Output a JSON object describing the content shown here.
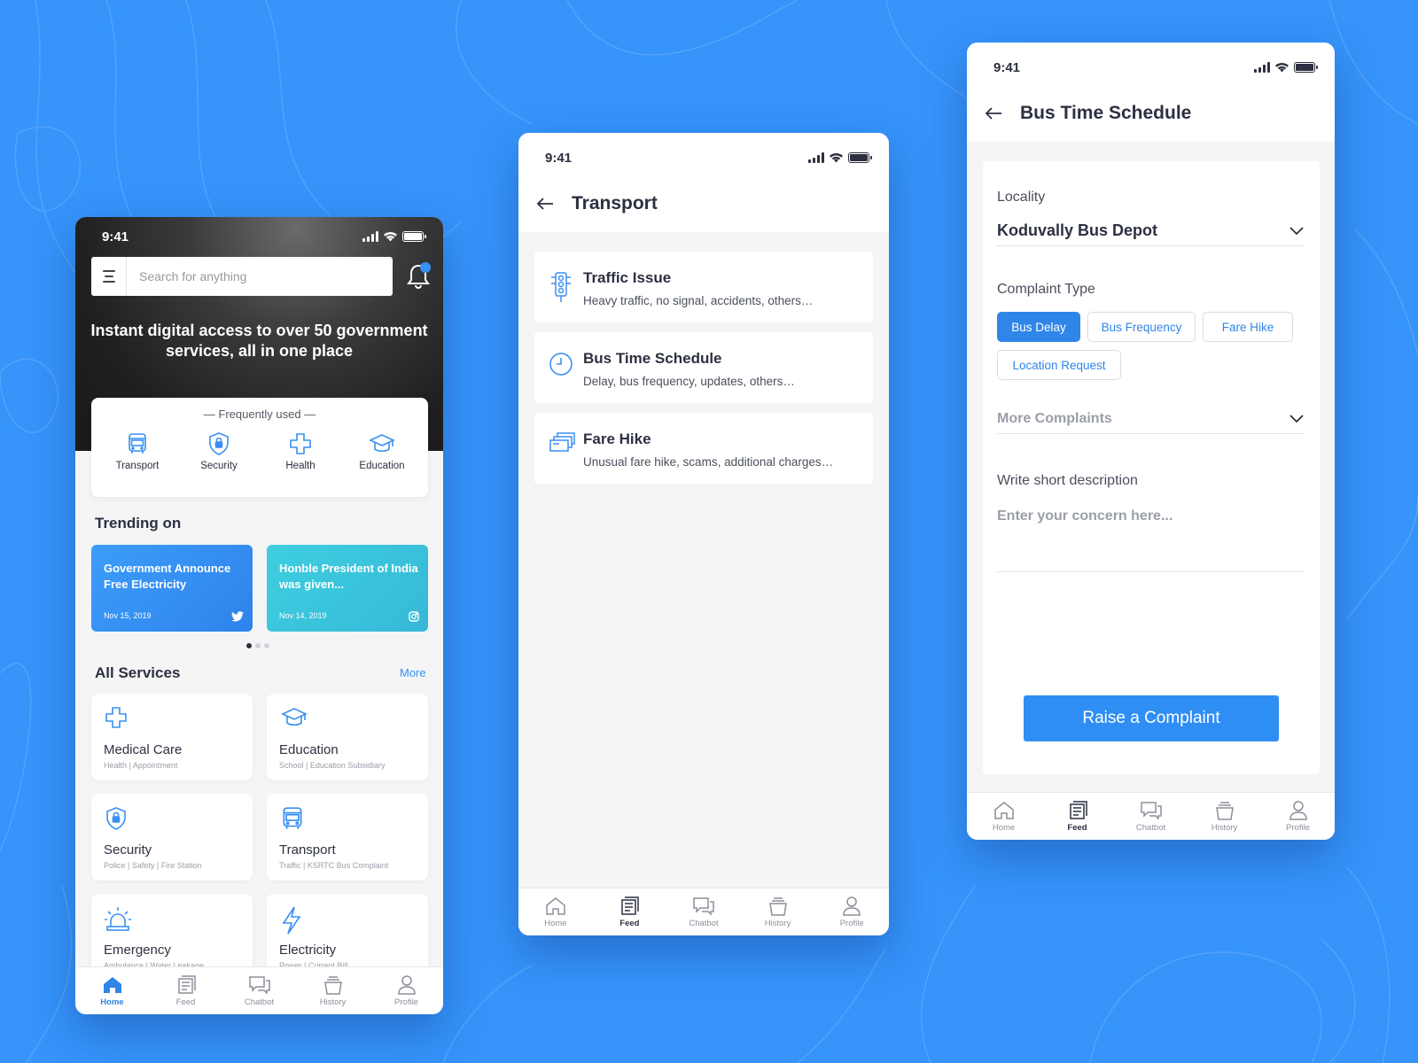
{
  "status_time": "9:41",
  "colors": {
    "background": "#3694fb",
    "accent": "#2f86e8",
    "trend_blue": "#3a96f6",
    "trend_teal": "#3fc6de"
  },
  "home": {
    "search_placeholder": "Search for anything",
    "hero_title": "Instant digital access to over 50 government services, all in one place",
    "frequently_used_title": "— Frequently used —",
    "frequently_used": [
      {
        "label": "Transport",
        "icon": "bus-icon"
      },
      {
        "label": "Security",
        "icon": "shield-lock-icon"
      },
      {
        "label": "Health",
        "icon": "medical-cross-icon"
      },
      {
        "label": "Education",
        "icon": "graduation-cap-icon"
      }
    ],
    "trending_title": "Trending on",
    "trending": [
      {
        "title": "Government Announce Free Electricity",
        "date": "Nov 15, 2019",
        "icon": "twitter-icon"
      },
      {
        "title": "Honble President of India was given...",
        "date": "Nov 14, 2019",
        "icon": "instagram-icon"
      }
    ],
    "carousel_active_index": 0,
    "all_services_title": "All Services",
    "more_label": "More",
    "services": [
      {
        "name": "Medical Care",
        "sub": "Health | Appointment",
        "icon": "medical-cross-icon"
      },
      {
        "name": "Education",
        "sub": "School | Education Subsidiary",
        "icon": "graduation-cap-icon"
      },
      {
        "name": "Security",
        "sub": "Police | Safety | Fire Station",
        "icon": "shield-lock-icon"
      },
      {
        "name": "Transport",
        "sub": "Traffic | KSRTC Bus Complaint",
        "icon": "bus-icon"
      },
      {
        "name": "Emergency",
        "sub": "Ambulance | Water Leakage",
        "icon": "siren-icon"
      },
      {
        "name": "Electricity",
        "sub": "Power | Current Bill",
        "icon": "lightning-icon"
      }
    ]
  },
  "tabs": [
    {
      "label": "Home",
      "icon": "home-icon"
    },
    {
      "label": "Feed",
      "icon": "feed-icon"
    },
    {
      "label": "Chatbot",
      "icon": "chat-icon"
    },
    {
      "label": "History",
      "icon": "history-icon"
    },
    {
      "label": "Profile",
      "icon": "profile-icon"
    }
  ],
  "transport": {
    "title": "Transport",
    "issues": [
      {
        "title": "Traffic Issue",
        "sub": "Heavy traffic, no signal, accidents, others…",
        "icon": "traffic-light-icon"
      },
      {
        "title": "Bus Time Schedule",
        "sub": "Delay, bus frequency, updates, others…",
        "icon": "clock-icon"
      },
      {
        "title": "Fare Hike",
        "sub": "Unusual fare hike, scams, additional charges…",
        "icon": "tickets-icon"
      }
    ]
  },
  "schedule": {
    "title": "Bus Time Schedule",
    "locality_label": "Locality",
    "locality_value": "Koduvally Bus Depot",
    "complaint_type_label": "Complaint Type",
    "complaint_types": [
      "Bus Delay",
      "Bus Frequency",
      "Fare Hike",
      "Location Request"
    ],
    "selected_complaint_type": "Bus Delay",
    "more_complaints_label": "More Complaints",
    "description_label": "Write short description",
    "description_placeholder": "Enter your concern here...",
    "submit_label": "Raise a Complaint"
  }
}
